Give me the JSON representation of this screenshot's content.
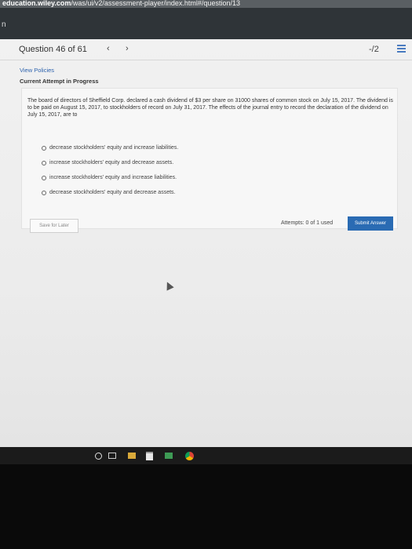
{
  "browser": {
    "url_host": "education.wiley.com",
    "url_rest": "/was/ui/v2/assessment-player/index.html#/question/13"
  },
  "question_header": {
    "title": "Question 46 of 61",
    "prev": "‹",
    "next": "›",
    "score": "-/2"
  },
  "links": {
    "view_policies": "View Policies",
    "attempt_status": "Current Attempt in Progress"
  },
  "question": {
    "text": "The board of directors of Sheffield Corp. declared a cash dividend of $3 per share on 31000 shares of common stock on July 15, 2017. The dividend is to be paid on August 15, 2017, to stockholders of record on July 31, 2017. The effects of the journal entry to record the declaration of the dividend on July 15, 2017, are to",
    "options": [
      "decrease stockholders' equity and increase liabilities.",
      "increase stockholders' equity and decrease assets.",
      "increase stockholders' equity and increase liabilities.",
      "decrease stockholders' equity and decrease assets."
    ]
  },
  "actions": {
    "save_label": "Save for Later",
    "attempts_text": "Attempts: 0 of 1 used",
    "submit_label": "Submit Answer"
  },
  "colors": {
    "link_blue": "#2d62ad",
    "submit_blue": "#2a6bb3"
  },
  "taskbar_icons": [
    "cortana-icon",
    "task-view-icon",
    "file-explorer-icon",
    "store-icon",
    "photos-icon",
    "chrome-icon"
  ]
}
